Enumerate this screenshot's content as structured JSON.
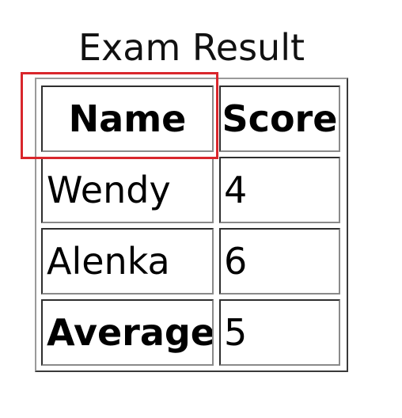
{
  "table": {
    "caption": "Exam Result",
    "headers": [
      "Name",
      "Score"
    ],
    "rows": [
      [
        "Wendy",
        "4"
      ],
      [
        "Alenka",
        "6"
      ],
      [
        "Average",
        "5"
      ]
    ]
  },
  "highlight": {
    "color": "#d9262c",
    "target": "Name"
  }
}
